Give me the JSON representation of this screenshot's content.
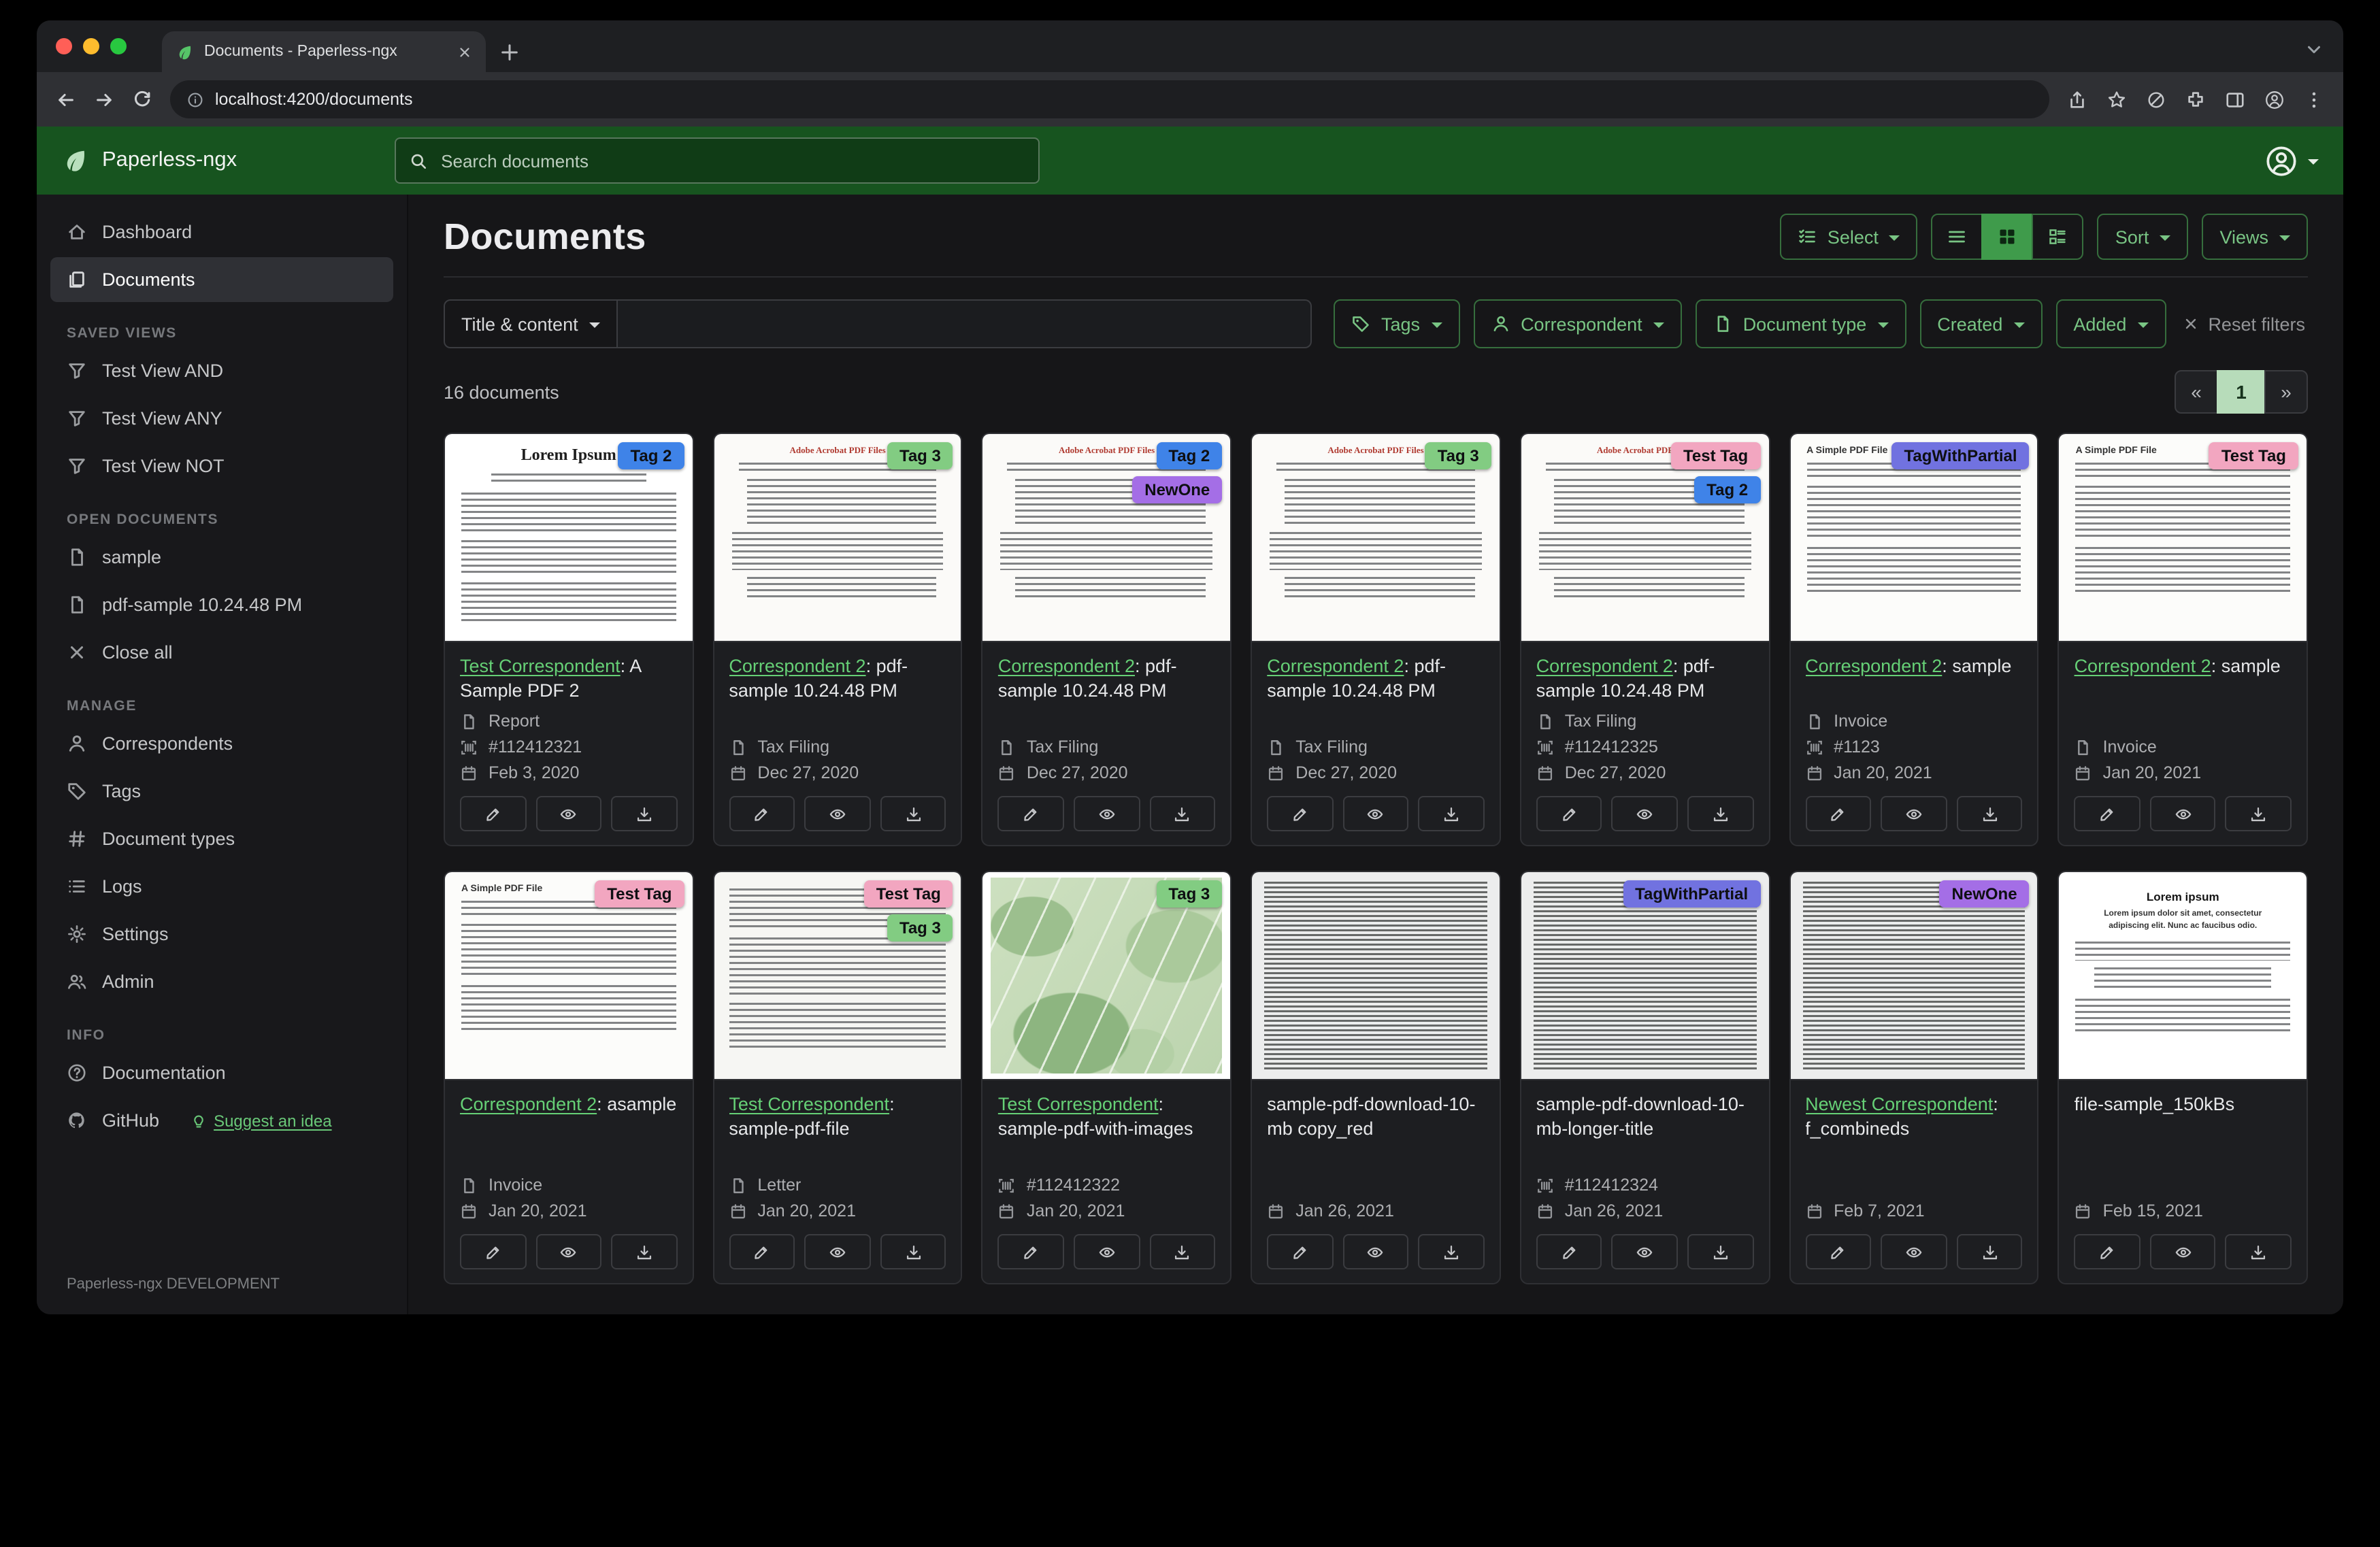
{
  "browser": {
    "tab_title": "Documents - Paperless-ngx",
    "url": "localhost:4200/documents"
  },
  "header": {
    "brand": "Paperless-ngx",
    "search_placeholder": "Search documents"
  },
  "sidebar": {
    "nav": [
      "Dashboard",
      "Documents"
    ],
    "saved_views_label": "SAVED VIEWS",
    "saved_views": [
      "Test View AND",
      "Test View ANY",
      "Test View NOT"
    ],
    "open_documents_label": "OPEN DOCUMENTS",
    "open_documents": [
      "sample",
      "pdf-sample 10.24.48 PM"
    ],
    "close_all": "Close all",
    "manage_label": "MANAGE",
    "manage": [
      "Correspondents",
      "Tags",
      "Document types",
      "Logs",
      "Settings",
      "Admin"
    ],
    "info_label": "INFO",
    "info": [
      "Documentation",
      "GitHub"
    ],
    "suggest": "Suggest an idea",
    "footer": "Paperless-ngx DEVELOPMENT"
  },
  "main": {
    "title": "Documents",
    "toolbar": {
      "select": "Select",
      "sort": "Sort",
      "views": "Views"
    },
    "filters": {
      "search_type": "Title & content",
      "tags": "Tags",
      "correspondent": "Correspondent",
      "document_type": "Document type",
      "created": "Created",
      "added": "Added",
      "reset": "Reset filters"
    },
    "count": "16 documents",
    "pagination": {
      "prev": "«",
      "page": "1",
      "next": "»"
    }
  },
  "ui": {
    "sep": ": "
  },
  "colors": {
    "header_green": "#17541f",
    "accent_green": "#79c584",
    "link_green": "#66d076",
    "toggle_active_green": "#3f9b4b",
    "pagination_active": "#b7dcba"
  },
  "cards": [
    {
      "tags": [
        {
          "label": "Tag 2",
          "color": "#3f83e8"
        }
      ],
      "correspondent": "Test Correspondent",
      "title": "A Sample PDF 2",
      "type": "Report",
      "asn": "#112412321",
      "date": "Feb 3, 2020",
      "thumb_title": "Lorem Ipsum"
    },
    {
      "tags": [
        {
          "label": "Tag 3",
          "color": "#82cc82"
        }
      ],
      "correspondent": "Correspondent 2",
      "title": "pdf-sample 10.24.48 PM",
      "type": "Tax Filing",
      "date": "Dec 27, 2020",
      "thumb_title": "Adobe Acrobat PDF Files"
    },
    {
      "tags": [
        {
          "label": "Tag 2",
          "color": "#3f83e8"
        },
        {
          "label": "NewOne",
          "color": "#a46ee6"
        }
      ],
      "correspondent": "Correspondent 2",
      "title": "pdf-sample 10.24.48 PM",
      "type": "Tax Filing",
      "date": "Dec 27, 2020",
      "thumb_title": "Adobe Acrobat PDF Files"
    },
    {
      "tags": [
        {
          "label": "Tag 3",
          "color": "#82cc82"
        }
      ],
      "correspondent": "Correspondent 2",
      "title": "pdf-sample 10.24.48 PM",
      "type": "Tax Filing",
      "date": "Dec 27, 2020",
      "thumb_title": "Adobe Acrobat PDF Files"
    },
    {
      "tags": [
        {
          "label": "Test Tag",
          "color": "#f2a6c0"
        },
        {
          "label": "Tag 2",
          "color": "#3f83e8"
        }
      ],
      "correspondent": "Correspondent 2",
      "title": "pdf-sample 10.24.48 PM",
      "type": "Tax Filing",
      "asn": "#112412325",
      "date": "Dec 27, 2020",
      "thumb_title": "Adobe Acrobat PDF Files"
    },
    {
      "tags": [
        {
          "label": "TagWithPartial",
          "color": "#7172e0"
        }
      ],
      "correspondent": "Correspondent 2",
      "title": "sample",
      "type": "Invoice",
      "asn": "#1123",
      "date": "Jan 20, 2021",
      "thumb_title": "A Simple PDF File"
    },
    {
      "tags": [
        {
          "label": "Test Tag",
          "color": "#f2a6c0"
        }
      ],
      "correspondent": "Correspondent 2",
      "title": "sample",
      "type": "Invoice",
      "date": "Jan 20, 2021",
      "thumb_title": "A Simple PDF File"
    },
    {
      "tags": [
        {
          "label": "Test Tag",
          "color": "#f2a6c0"
        }
      ],
      "correspondent": "Correspondent 2",
      "title": "asample",
      "type": "Invoice",
      "date": "Jan 20, 2021",
      "thumb_title": "A Simple PDF File"
    },
    {
      "tags": [
        {
          "label": "Test Tag",
          "color": "#f2a6c0"
        },
        {
          "label": "Tag 3",
          "color": "#82cc82"
        }
      ],
      "correspondent": "Test Correspondent",
      "title": "sample-pdf-file",
      "type": "Letter",
      "date": "Jan 20, 2021"
    },
    {
      "tags": [
        {
          "label": "Tag 3",
          "color": "#82cc82"
        }
      ],
      "correspondent": "Test Correspondent",
      "title": "sample-pdf-with-images",
      "asn": "#112412322",
      "date": "Jan 20, 2021"
    },
    {
      "tags": [],
      "title": "sample-pdf-download-10-mb copy_red",
      "date": "Jan 26, 2021"
    },
    {
      "tags": [
        {
          "label": "TagWithPartial",
          "color": "#7172e0"
        }
      ],
      "title": "sample-pdf-download-10-mb-longer-title",
      "asn": "#112412324",
      "date": "Jan 26, 2021"
    },
    {
      "tags": [
        {
          "label": "NewOne",
          "color": "#a46ee6"
        }
      ],
      "correspondent": "Newest Correspondent",
      "title": "f_combineds",
      "date": "Feb 7, 2021"
    },
    {
      "tags": [],
      "title": "file-sample_150kBs",
      "date": "Feb 15, 2021",
      "thumb_title": "Lorem ipsum",
      "thumb_sub": "Lorem ipsum dolor sit amet, consectetur adipiscing elit. Nunc ac faucibus odio."
    }
  ]
}
